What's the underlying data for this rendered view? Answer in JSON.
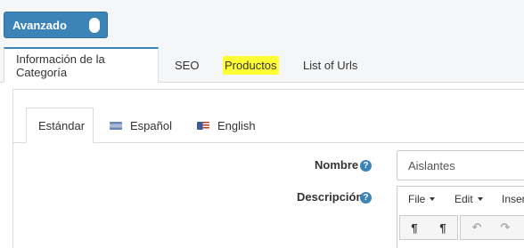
{
  "toggle": {
    "label": "Avanzado"
  },
  "tabs": [
    {
      "label": "Información de la Categoría"
    },
    {
      "label": "SEO"
    },
    {
      "label": "Productos"
    },
    {
      "label": "List of Urls"
    }
  ],
  "lang_tabs": [
    {
      "label": "Estándar"
    },
    {
      "label": "Español"
    },
    {
      "label": "English"
    }
  ],
  "form": {
    "nombre_label": "Nombre",
    "nombre_value": "Aislantes",
    "descripcion_label": "Descripción",
    "help_glyph": "?"
  },
  "editor": {
    "menu": [
      {
        "label": "File"
      },
      {
        "label": "Edit"
      },
      {
        "label": "Inser"
      }
    ],
    "toolbar": [
      {
        "glyph": "¶",
        "icon": "ltr-paragraph-icon"
      },
      {
        "glyph": "¶",
        "icon": "rtl-paragraph-icon"
      },
      {
        "glyph": "↶",
        "icon": "undo-icon"
      },
      {
        "glyph": "↷",
        "icon": "redo-icon"
      }
    ]
  },
  "colors": {
    "accent": "#3c84b8",
    "highlight": "#ffff33"
  }
}
